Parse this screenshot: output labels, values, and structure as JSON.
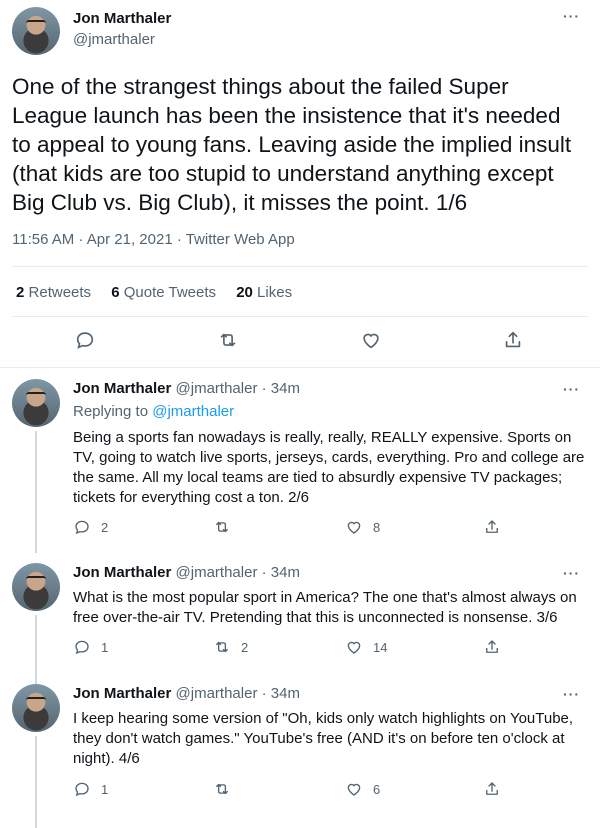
{
  "main_tweet": {
    "author_name": "Jon Marthaler",
    "author_handle": "@jmarthaler",
    "text": "One of the strangest things about the failed Super League launch has been the insistence that it's needed to appeal to young fans. Leaving aside the implied insult (that kids are too stupid to understand anything except Big Club vs. Big Club), it misses the point. 1/6",
    "timestamp": "11:56 AM · Apr 21, 2021 · Twitter Web App",
    "retweets_count": "2",
    "retweets_label": "Retweets",
    "quote_count": "6",
    "quote_label": "Quote Tweets",
    "likes_count": "20",
    "likes_label": "Likes"
  },
  "replies": [
    {
      "author_name": "Jon Marthaler",
      "author_handle": "@jmarthaler · 34m",
      "replying_prefix": "Replying to ",
      "replying_handle": "@jmarthaler",
      "text": "Being a sports fan nowadays is really, really, REALLY expensive. Sports on TV, going to watch live sports, jerseys, cards, everything. Pro and college are the same. All my local teams are tied to absurdly expensive TV packages; tickets for everything cost a ton. 2/6",
      "reply_count": "2",
      "retweet_count": "",
      "like_count": "8"
    },
    {
      "author_name": "Jon Marthaler",
      "author_handle": "@jmarthaler · 34m",
      "text": "What is the most popular sport in America? The one that's almost always on free over-the-air TV. Pretending that this is unconnected is nonsense. 3/6",
      "reply_count": "1",
      "retweet_count": "2",
      "like_count": "14"
    },
    {
      "author_name": "Jon Marthaler",
      "author_handle": "@jmarthaler · 34m",
      "text": "I keep hearing some version of \"Oh, kids only watch highlights on YouTube, they don't watch games.\" YouTube's free (AND it's on before ten o'clock at night). 4/6",
      "reply_count": "1",
      "retweet_count": "",
      "like_count": "6"
    }
  ],
  "more_label": "···",
  "icons": {
    "reply": "reply-icon",
    "retweet": "retweet-icon",
    "like": "heart-icon",
    "share": "share-icon",
    "more": "more-icon"
  },
  "colors": {
    "text": "#0f1419",
    "secondary": "#536471",
    "link": "#1d9bf0",
    "divider": "#e6ecf0"
  }
}
